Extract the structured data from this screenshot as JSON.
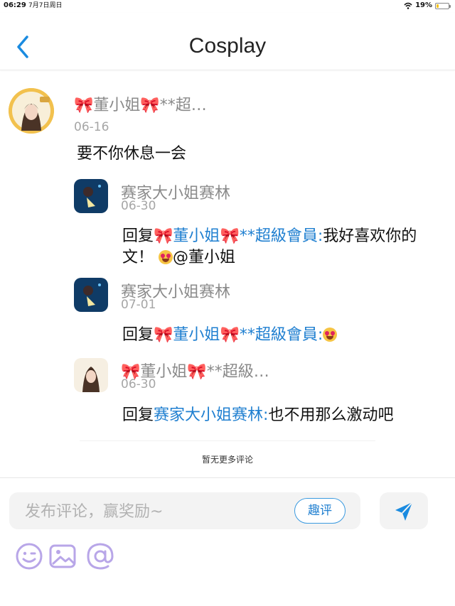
{
  "status": {
    "time": "06:29",
    "date": "7月7日周日",
    "battery": "19%",
    "battery_level": 0.19
  },
  "header": {
    "title": "Cosplay"
  },
  "comment": {
    "author": "🎀董小姐🎀**超…",
    "date": "06-16",
    "text": "要不你休息一会"
  },
  "replies": [
    {
      "author": "赛家大小姐赛林",
      "date": "06-30",
      "prefix": "回复",
      "target_bow1": "🎀",
      "target_name": "董小姐",
      "target_bow2": "🎀",
      "target_suffix": "**超級會員:",
      "line1_rest": "我好喜欢你的",
      "line2": "文！",
      "line2_rest": "@董小姐"
    },
    {
      "author": "赛家大小姐赛林",
      "date": "07-01",
      "prefix": "回复",
      "target_bow1": "🎀",
      "target_name": "董小姐",
      "target_bow2": "🎀",
      "target_suffix": "**超級會員:"
    },
    {
      "author": "🎀董小姐🎀**超級…",
      "date": "06-30",
      "prefix": "回复",
      "target_name": "赛家大小姐赛林:",
      "text": "也不用那么激动吧"
    }
  ],
  "no_more": "暂无更多评论",
  "input": {
    "placeholder": "发布评论，赢奖励~",
    "fun_label": "趣评"
  },
  "colors": {
    "link": "#1f7fd0",
    "accent": "#1a8be0",
    "tool_icon": "#b8a6e8"
  },
  "icons": [
    "back-arrow-icon",
    "send-icon",
    "emoji-icon",
    "image-icon",
    "mention-icon"
  ]
}
